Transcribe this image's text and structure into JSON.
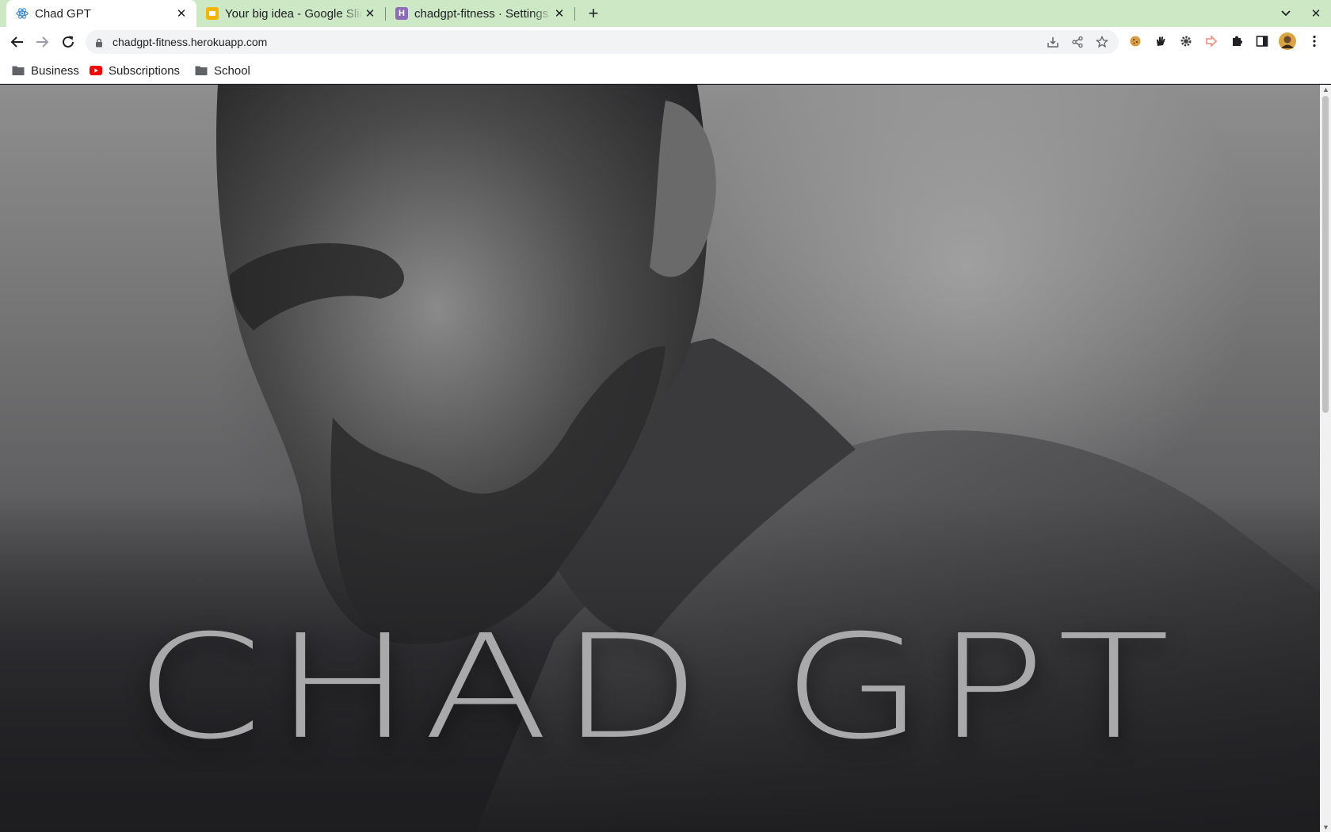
{
  "browser": {
    "tabs": [
      {
        "title": "Chad GPT",
        "favicon": "react-logo-icon",
        "active": true
      },
      {
        "title": "Your big idea - Google Slides",
        "favicon": "google-slides-icon",
        "active": false
      },
      {
        "title": "chadgpt-fitness · Settings",
        "favicon": "heroku-icon",
        "active": false
      }
    ],
    "address": "chadgpt-fitness.herokuapp.com",
    "bookmarks": [
      {
        "label": "Business",
        "icon": "folder-icon"
      },
      {
        "label": "Subscriptions",
        "icon": "youtube-icon"
      },
      {
        "label": "School",
        "icon": "folder-icon"
      }
    ],
    "extensions": [
      "cookie-icon",
      "hand-icon",
      "gear-icon",
      "arrow-extension-icon",
      "puzzle-icon",
      "side-panel-icon",
      "avatar"
    ]
  },
  "page": {
    "hero_title": "CHAD GPT"
  },
  "colors": {
    "tab_strip": "#cde8c4",
    "hero_text": "#a9a9ab",
    "page_dark": "#1d1d20"
  }
}
